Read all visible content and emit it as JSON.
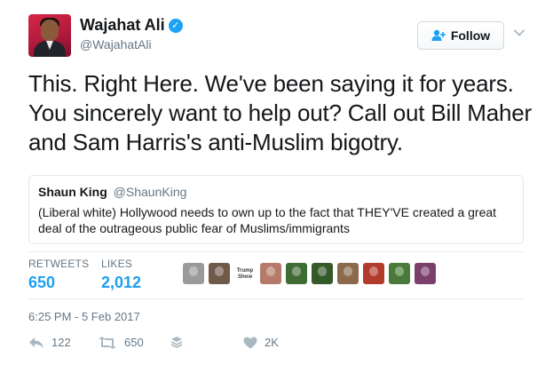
{
  "author": {
    "name": "Wajahat Ali",
    "handle": "@WajahatAli",
    "verified": true
  },
  "follow_button": {
    "label": "Follow"
  },
  "tweet": {
    "text": "This. Right Here. We've been saying it for years. You sincerely want to help out? Call out Bill Maher and Sam Harris's anti-Muslim bigotry."
  },
  "quoted_tweet": {
    "name": "Shaun King",
    "handle": "@ShaunKing",
    "text": "(Liberal white) Hollywood needs to own up to the fact that THEY'VE created a great deal of the outrageous public fear of Muslims/immigrants"
  },
  "stats": {
    "retweets_label": "RETWEETS",
    "retweets": "650",
    "likes_label": "LIKES",
    "likes": "2,012"
  },
  "likers": {
    "items": [
      {
        "color": "#9a9a9a"
      },
      {
        "color": "#6f5a4a"
      },
      {
        "color": "#caa45a",
        "badge": "Trump\nShow"
      },
      {
        "color": "#b57a6a"
      },
      {
        "color": "#3f6b34"
      },
      {
        "color": "#355a2a"
      },
      {
        "color": "#8a6a4a"
      },
      {
        "color": "#b33b2c"
      },
      {
        "color": "#4a7a3a"
      },
      {
        "color": "#7a3f6a"
      }
    ]
  },
  "timestamp": "6:25 PM - 5 Feb 2017",
  "actions": {
    "reply_count": "122",
    "retweet_count": "650",
    "like_count": "2K"
  },
  "colors": {
    "accent": "#1da1f2",
    "secondary_text": "#657786",
    "border": "#e1e8ed"
  }
}
